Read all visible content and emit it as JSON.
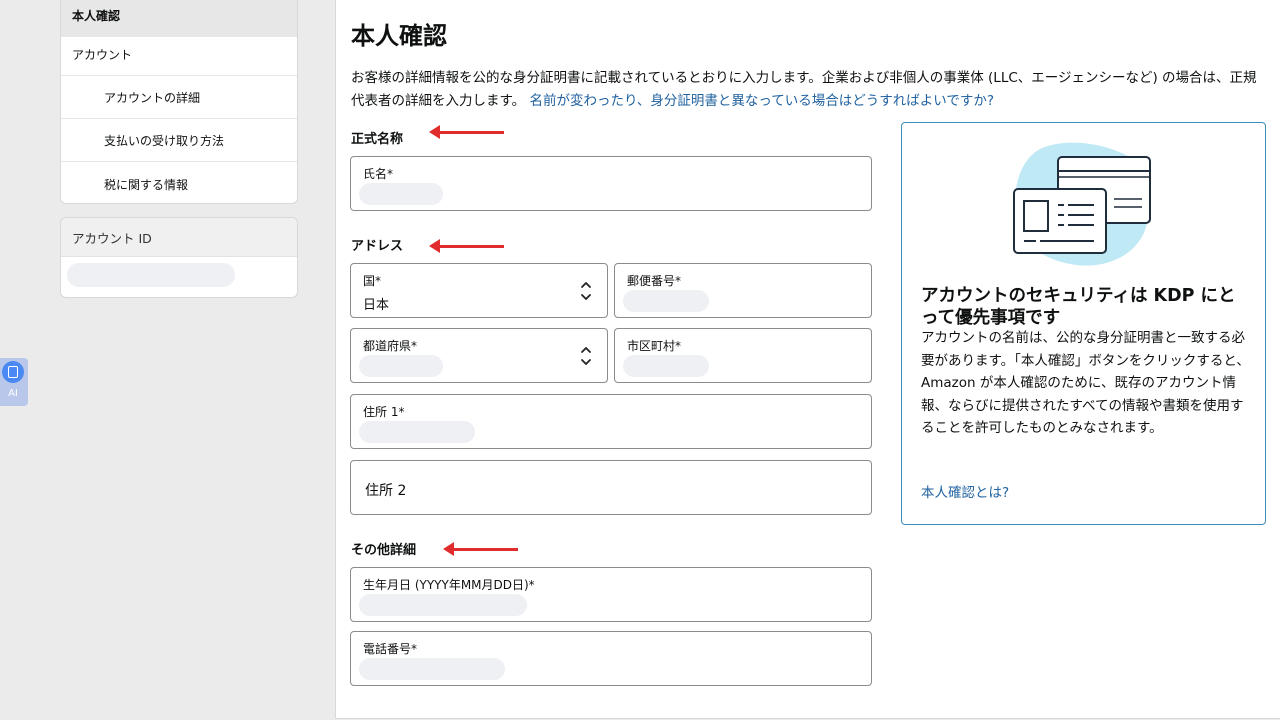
{
  "sidebar": {
    "items": [
      {
        "label": "本人確認"
      },
      {
        "label": "アカウント"
      },
      {
        "label": "アカウントの詳細"
      },
      {
        "label": "支払いの受け取り方法"
      },
      {
        "label": "税に関する情報"
      }
    ],
    "account_id_label": "アカウント ID"
  },
  "ai_widget": {
    "label": "AI",
    "icon": "document-icon"
  },
  "main": {
    "title": "本人確認",
    "intro_text": "お客様の詳細情報を公的な身分証明書に記載されているとおりに入力します。企業および非個人の事業体 (LLC、エージェンシーなど) の場合は、正規代表者の詳細を入力します。",
    "intro_link": "名前が変わったり、身分証明書と異なっている場合はどうすればよいですか?",
    "sections": {
      "official_name": "正式名称",
      "address": "アドレス",
      "other": "その他詳細"
    },
    "fields": {
      "name": {
        "label": "氏名*"
      },
      "country": {
        "label": "国*",
        "value": "日本"
      },
      "postal": {
        "label": "郵便番号*"
      },
      "prefecture": {
        "label": "都道府県*"
      },
      "city": {
        "label": "市区町村*"
      },
      "address1": {
        "label": "住所 1*"
      },
      "address2": {
        "placeholder": "住所 2"
      },
      "birthdate": {
        "label": "生年月日 (YYYY年MM月DD日)*"
      },
      "phone": {
        "label": "電話番号*"
      }
    }
  },
  "info_card": {
    "heading": "アカウントのセキュリティは KDP にとって優先事項です",
    "body": "アカウントの名前は、公的な身分証明書と一致する必要があります。「本人確認」ボタンをクリックすると、Amazon が本人確認のために、既存のアカウント情報、ならびに提供されたすべての情報や書類を使用することを許可したものとみなされます。",
    "link": "本人確認とは?"
  },
  "colors": {
    "accent_link": "#2162a1",
    "card_border": "#3a8fb7",
    "arrow": "#e02c2c",
    "illustration_blob": "#bfe9f5"
  }
}
